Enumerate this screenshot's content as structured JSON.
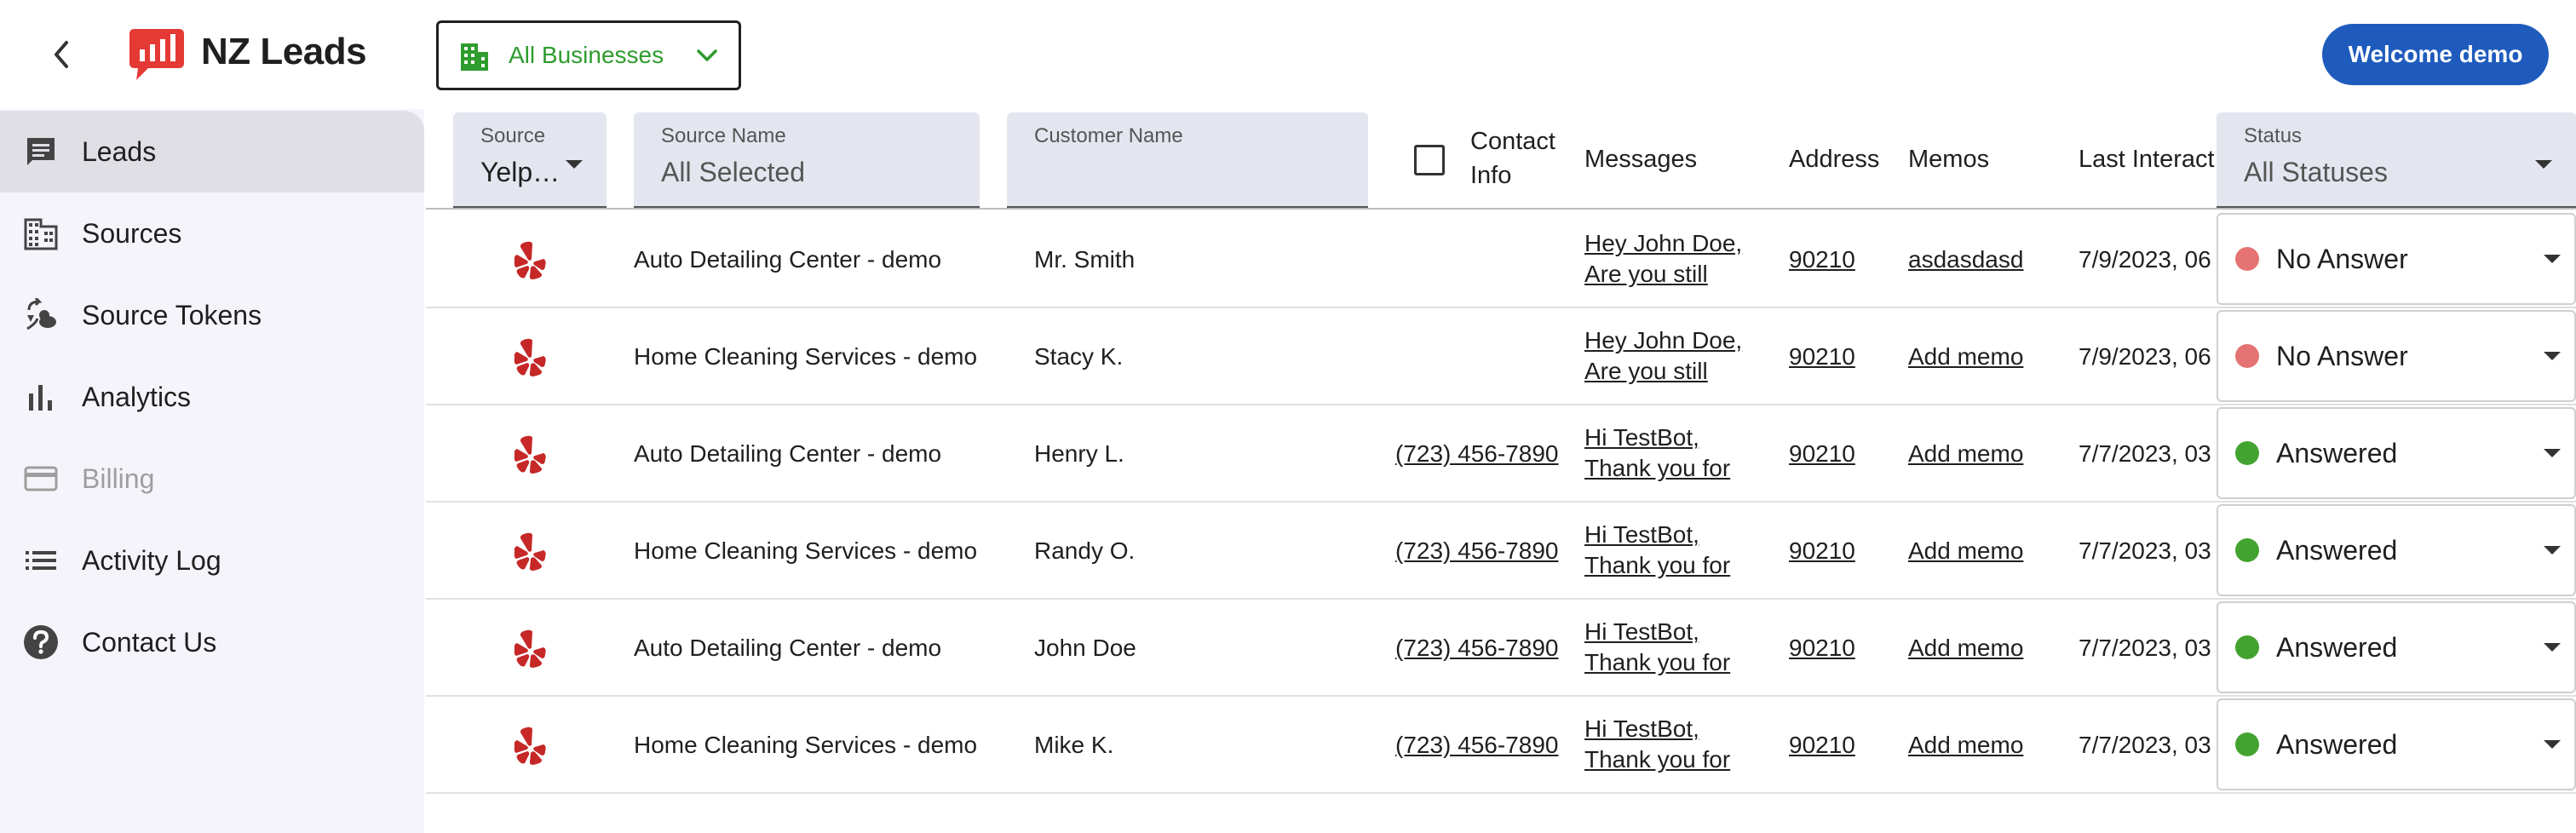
{
  "header": {
    "app_title": "NZ Leads",
    "business_filter": "All Businesses",
    "welcome": "Welcome demo"
  },
  "sidebar": {
    "items": [
      {
        "label": "Leads",
        "icon": "chat-icon",
        "active": true
      },
      {
        "label": "Sources",
        "icon": "building-icon"
      },
      {
        "label": "Source Tokens",
        "icon": "source-tokens-icon"
      },
      {
        "label": "Analytics",
        "icon": "bar-chart-icon"
      },
      {
        "label": "Billing",
        "icon": "credit-card-icon",
        "disabled": true
      },
      {
        "label": "Activity Log",
        "icon": "list-icon"
      },
      {
        "label": "Contact Us",
        "icon": "help-icon"
      }
    ]
  },
  "table": {
    "filters": {
      "source_label": "Source",
      "source_value": "Yelp…",
      "source_name_label": "Source Name",
      "source_name_value": "All Selected",
      "customer_name_label": "Customer Name",
      "status_label": "Status",
      "status_value": "All Statuses"
    },
    "headers": {
      "contact_info_1": "Contact",
      "contact_info_2": "Info",
      "messages": "Messages",
      "address": "Address",
      "memos": "Memos",
      "last_interaction": "Last Interact"
    },
    "rows": [
      {
        "source_icon": "yelp-icon",
        "source_name": "Auto Detailing Center - demo",
        "customer": "Mr. Smith",
        "contact": "",
        "msg1": "Hey John Doe,",
        "msg2": "Are you still",
        "address": "90210",
        "memo": "asdasdasd",
        "last": "7/9/2023, 06",
        "status": "No Answer",
        "status_color": "#e57373"
      },
      {
        "source_icon": "yelp-icon",
        "source_name": "Home Cleaning Services - demo",
        "customer": "Stacy K.",
        "contact": "",
        "msg1": "Hey John Doe,",
        "msg2": "Are you still",
        "address": "90210",
        "memo": "Add memo",
        "last": "7/9/2023, 06",
        "status": "No Answer",
        "status_color": "#e57373"
      },
      {
        "source_icon": "yelp-icon",
        "source_name": "Auto Detailing Center - demo",
        "customer": "Henry L.",
        "contact": "(723) 456-7890",
        "msg1": "Hi TestBot,",
        "msg2": "Thank you for",
        "address": "90210",
        "memo": "Add memo",
        "last": "7/7/2023, 03",
        "status": "Answered",
        "status_color": "#43a330"
      },
      {
        "source_icon": "yelp-icon",
        "source_name": "Home Cleaning Services - demo",
        "customer": "Randy O.",
        "contact": "(723) 456-7890",
        "msg1": "Hi TestBot,",
        "msg2": "Thank you for",
        "address": "90210",
        "memo": "Add memo",
        "last": "7/7/2023, 03",
        "status": "Answered",
        "status_color": "#43a330"
      },
      {
        "source_icon": "yelp-icon",
        "source_name": "Auto Detailing Center - demo",
        "customer": "John Doe",
        "contact": "(723) 456-7890",
        "msg1": "Hi TestBot,",
        "msg2": "Thank you for",
        "address": "90210",
        "memo": "Add memo",
        "last": "7/7/2023, 03",
        "status": "Answered",
        "status_color": "#43a330"
      },
      {
        "source_icon": "yelp-icon",
        "source_name": "Home Cleaning Services - demo",
        "customer": "Mike K.",
        "contact": "(723) 456-7890",
        "msg1": "Hi TestBot,",
        "msg2": "Thank you for",
        "address": "90210",
        "memo": "Add memo",
        "last": "7/7/2023, 03",
        "status": "Answered",
        "status_color": "#43a330"
      }
    ]
  },
  "colors": {
    "accent": "#1e5bbd",
    "business_green": "#2e9c2e",
    "logo_red": "#e53935",
    "yelp_red": "#c62828"
  }
}
